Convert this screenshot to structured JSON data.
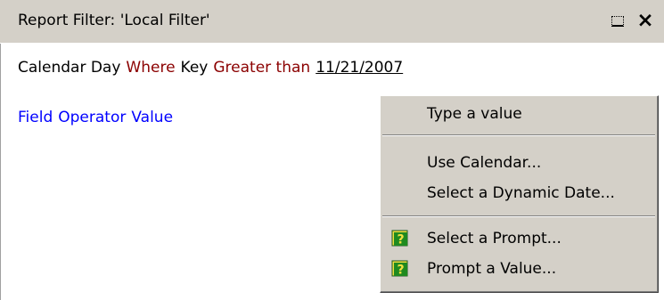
{
  "panel": {
    "title": "Report Filter: 'Local Filter'"
  },
  "window_controls": {
    "pin_icon": "pin-icon",
    "close_glyph": "×"
  },
  "condition": {
    "field": "Calendar Day",
    "keyword": "Where",
    "attribute": "Key",
    "operator": "Greater than",
    "value": "11/21/2007"
  },
  "new_condition": {
    "field": "Field",
    "operator": "Operator",
    "value": "Value"
  },
  "context_menu": {
    "items": [
      {
        "label": "Type a value",
        "icon": ""
      },
      {
        "label": "Use Calendar...",
        "icon": ""
      },
      {
        "label": "Select a Dynamic Date...",
        "icon": ""
      },
      {
        "label": "Select a Prompt...",
        "icon": "prompt-question-icon"
      },
      {
        "label": "Prompt a Value...",
        "icon": "prompt-question-icon"
      }
    ]
  },
  "colors": {
    "title_bar": "#d4d0c8",
    "keyword_red": "#8b0000",
    "link_blue": "#0000ff",
    "icon_green": "#1f8a1f",
    "icon_yellow": "#f0e040"
  }
}
